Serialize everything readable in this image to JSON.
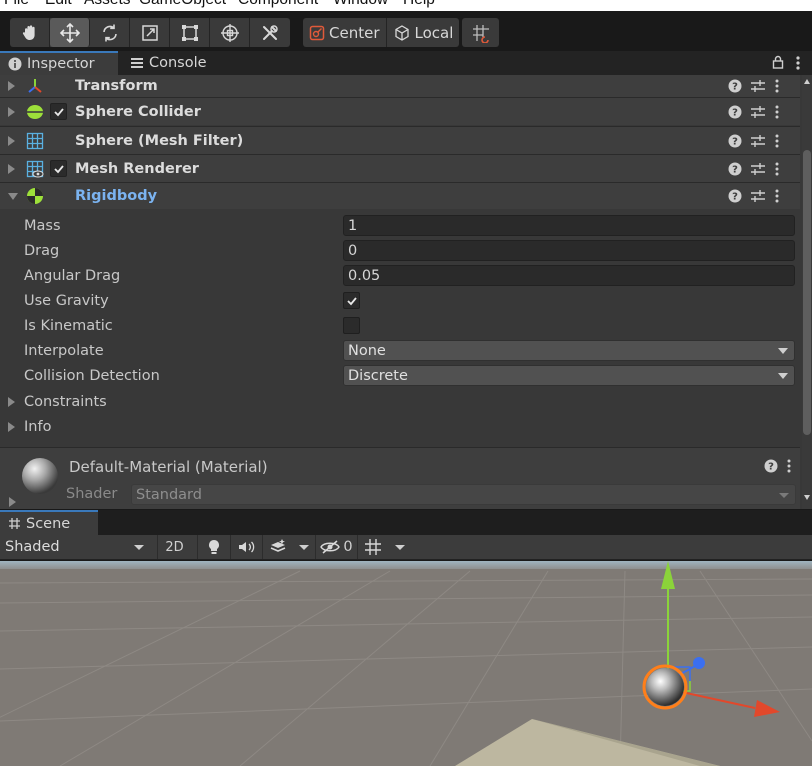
{
  "menubar": {
    "items": [
      "File",
      "Edit",
      "Assets",
      "GameObject",
      "Component",
      "Window",
      "Help"
    ]
  },
  "toolbar": {
    "tools": [
      "hand-tool",
      "move-tool",
      "rotate-tool",
      "scale-tool",
      "rect-tool",
      "transform-tool",
      "custom-tool"
    ],
    "pivot_label": "Center",
    "space_label": "Local"
  },
  "tabs": {
    "inspector": "Inspector",
    "console": "Console"
  },
  "components": [
    {
      "name": "Transform",
      "icon": "transform-icon",
      "has_checkbox": false,
      "expanded": false
    },
    {
      "name": "Sphere Collider",
      "icon": "sphere-collider-icon",
      "has_checkbox": true,
      "checked": true,
      "expanded": false
    },
    {
      "name": "Sphere (Mesh Filter)",
      "icon": "mesh-filter-icon",
      "has_checkbox": false,
      "expanded": false
    },
    {
      "name": "Mesh Renderer",
      "icon": "mesh-renderer-icon",
      "has_checkbox": true,
      "checked": true,
      "expanded": false
    },
    {
      "name": "Rigidbody",
      "icon": "rigidbody-icon",
      "has_checkbox": false,
      "expanded": true
    }
  ],
  "rigidbody": {
    "mass_label": "Mass",
    "mass_value": "1",
    "drag_label": "Drag",
    "drag_value": "0",
    "angular_drag_label": "Angular Drag",
    "angular_drag_value": "0.05",
    "use_gravity_label": "Use Gravity",
    "use_gravity": true,
    "is_kinematic_label": "Is Kinematic",
    "is_kinematic": false,
    "interpolate_label": "Interpolate",
    "interpolate_value": "None",
    "collision_label": "Collision Detection",
    "collision_value": "Discrete",
    "constraints_label": "Constraints",
    "info_label": "Info"
  },
  "material": {
    "name": "Default-Material (Material)",
    "shader_label": "Shader",
    "shader_value": "Standard"
  },
  "scene": {
    "tab_label": "Scene",
    "shading_mode": "Shaded",
    "mode_2d": "2D",
    "hidden_count": "0"
  },
  "colors": {
    "accent_blue": "#7bb3f0",
    "tab_highlight": "#3a79bb",
    "gizmo_y": "#8bd33a",
    "gizmo_x": "#e2482b",
    "gizmo_z": "#3b6ff0",
    "selection_outline": "#ff7f1a"
  }
}
